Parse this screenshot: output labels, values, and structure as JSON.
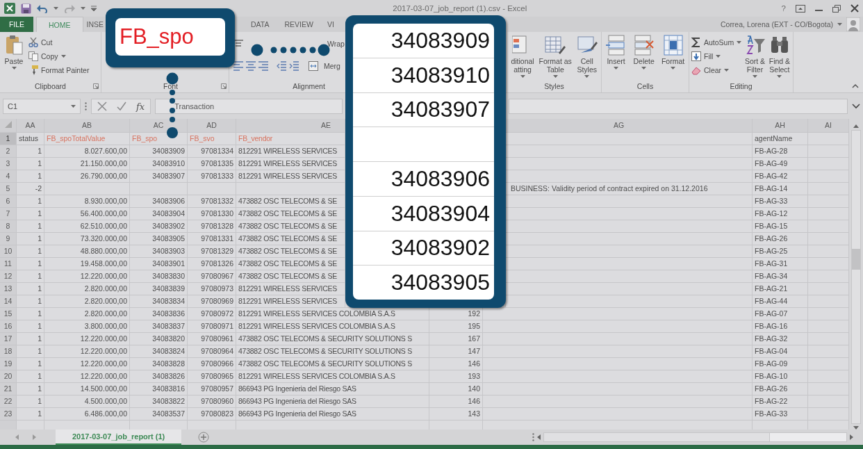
{
  "window": {
    "title": "2017-03-07_job_report (1).csv - Excel",
    "help": "?",
    "user": "Correa, Lorena (EXT - CO/Bogota)"
  },
  "ribbon_tabs": [
    {
      "label": "FILE",
      "kind": "file",
      "selected": false
    },
    {
      "label": "HOME",
      "kind": "tab",
      "selected": true
    },
    {
      "label": "INSE",
      "kind": "tab",
      "selected": false
    },
    {
      "label": "DATA",
      "kind": "tab",
      "selected": false
    },
    {
      "label": "REVIEW",
      "kind": "tab",
      "selected": false
    },
    {
      "label": "VI",
      "kind": "tab",
      "selected": false
    }
  ],
  "ribbon_groups": [
    {
      "label": "Clipboard",
      "commands": [
        {
          "label": "Paste",
          "kind": "large",
          "menu": true
        },
        {
          "label": "Cut",
          "kind": "small",
          "menu": false
        },
        {
          "label": "Copy",
          "kind": "small",
          "menu": true
        },
        {
          "label": "Format Painter",
          "kind": "small",
          "menu": false
        }
      ]
    },
    {
      "label": "Font"
    },
    {
      "label": "Alignment",
      "commands": [
        {
          "label": "Wrap",
          "kind": "small",
          "menu": false
        },
        {
          "label": "Merg",
          "kind": "small",
          "menu": false
        }
      ]
    },
    {
      "label": "Styles",
      "commands": [
        {
          "label": "ditional atting",
          "kind": "large",
          "menu": true
        },
        {
          "label": "Format as Table",
          "kind": "large",
          "menu": true
        },
        {
          "label": "Cell Styles",
          "kind": "large",
          "menu": true
        }
      ]
    },
    {
      "label": "Cells",
      "commands": [
        {
          "label": "Insert",
          "kind": "large",
          "menu": true
        },
        {
          "label": "Delete",
          "kind": "large",
          "menu": true
        },
        {
          "label": "Format",
          "kind": "large",
          "menu": true
        }
      ]
    },
    {
      "label": "Editing",
      "commands": [
        {
          "label": "AutoSum",
          "kind": "small",
          "menu": true
        },
        {
          "label": "Fill",
          "kind": "small",
          "menu": true
        },
        {
          "label": "Clear",
          "kind": "small",
          "menu": true
        },
        {
          "label": "Sort & Filter",
          "kind": "large",
          "menu": true
        },
        {
          "label": "Find & Select",
          "kind": "large",
          "menu": true
        }
      ]
    }
  ],
  "formula_bar": {
    "name_box": "C1",
    "function_label": "fx",
    "formula": "Transaction"
  },
  "sheet": {
    "columns": [
      {
        "label": "AA",
        "highlighted": false
      },
      {
        "label": "AB",
        "highlighted": true
      },
      {
        "label": "AC",
        "highlighted": true
      },
      {
        "label": "AD",
        "highlighted": true
      },
      {
        "label": "AE",
        "highlighted": true
      },
      {},
      {
        "label": "AG"
      },
      {
        "label": "AH",
        "highlighted": false
      },
      {
        "label": "AI"
      }
    ],
    "rows": [
      {
        "number": "1",
        "selected": true,
        "cells": [
          "status",
          "FB_spoTotalValue",
          "FB_spo",
          "FB_svo",
          "FB_vendor",
          null,
          null,
          "agentName"
        ]
      },
      {
        "number": "2",
        "selected": false,
        "cells": [
          "1",
          "8.027.600,00",
          "34083909",
          "97081334",
          "812291 WIRELESS SERVICES",
          null,
          null,
          "FB-AG-28"
        ]
      },
      {
        "number": "3",
        "selected": false,
        "cells": [
          "1",
          "21.150.000,00",
          "34083910",
          "97081335",
          "812291 WIRELESS SERVICES",
          null,
          null,
          "FB-AG-49"
        ]
      },
      {
        "number": "4",
        "selected": false,
        "cells": [
          "1",
          "26.790.000,00",
          "34083907",
          "97081333",
          "812291 WIRELESS SERVICES",
          null,
          null,
          "FB-AG-42"
        ]
      },
      {
        "number": "5",
        "selected": false,
        "cells": [
          "-2",
          null,
          null,
          null,
          null,
          null,
          "BUSINESS: Validity period of contract expired on 31.12.2016",
          "FB-AG-14"
        ]
      },
      {
        "number": "6",
        "selected": false,
        "cells": [
          "1",
          "8.930.000,00",
          "34083906",
          "97081332",
          "473882 OSC TELECOMS & SE",
          null,
          null,
          "FB-AG-33"
        ]
      },
      {
        "number": "7",
        "selected": false,
        "cells": [
          "1",
          "56.400.000,00",
          "34083904",
          "97081330",
          "473882 OSC TELECOMS & SE",
          null,
          null,
          "FB-AG-12"
        ]
      },
      {
        "number": "8",
        "selected": false,
        "cells": [
          "1",
          "62.510.000,00",
          "34083902",
          "97081328",
          "473882 OSC TELECOMS & SE",
          null,
          null,
          "FB-AG-15"
        ]
      },
      {
        "number": "9",
        "selected": false,
        "cells": [
          "1",
          "73.320.000,00",
          "34083905",
          "97081331",
          "473882 OSC TELECOMS & SE",
          null,
          null,
          "FB-AG-26"
        ]
      },
      {
        "number": "10",
        "selected": false,
        "cells": [
          "1",
          "48.880.000,00",
          "34083903",
          "97081329",
          "473882 OSC TELECOMS & SE",
          null,
          null,
          "FB-AG-25"
        ]
      },
      {
        "number": "11",
        "selected": false,
        "cells": [
          "1",
          "19.458.000,00",
          "34083901",
          "97081326",
          "473882 OSC TELECOMS & SE",
          null,
          null,
          "FB-AG-31"
        ]
      },
      {
        "number": "12",
        "selected": false,
        "cells": [
          "1",
          "12.220.000,00",
          "34083830",
          "97080967",
          "473882 OSC TELECOMS & SE",
          null,
          null,
          "FB-AG-34"
        ]
      },
      {
        "number": "13",
        "selected": false,
        "cells": [
          "1",
          "2.820.000,00",
          "34083839",
          "97080973",
          "812291 WIRELESS SERVICES",
          null,
          null,
          "FB-AG-21"
        ]
      },
      {
        "number": "14",
        "selected": false,
        "cells": [
          "1",
          "2.820.000,00",
          "34083834",
          "97080969",
          "812291 WIRELESS SERVICES",
          null,
          null,
          "FB-AG-44"
        ]
      },
      {
        "number": "15",
        "selected": false,
        "cells": [
          "1",
          "2.820.000,00",
          "34083836",
          "97080972",
          "812291 WIRELESS SERVICES COLOMBIA S.A.S",
          "192",
          null,
          "FB-AG-07"
        ]
      },
      {
        "number": "16",
        "selected": false,
        "cells": [
          "1",
          "3.800.000,00",
          "34083837",
          "97080971",
          "812291 WIRELESS SERVICES COLOMBIA S.A.S",
          "195",
          null,
          "FB-AG-16"
        ]
      },
      {
        "number": "17",
        "selected": false,
        "cells": [
          "1",
          "12.220.000,00",
          "34083820",
          "97080961",
          "473882 OSC TELECOMS & SECURITY SOLUTIONS S",
          "167",
          null,
          "FB-AG-32"
        ]
      },
      {
        "number": "18",
        "selected": false,
        "cells": [
          "1",
          "12.220.000,00",
          "34083824",
          "97080964",
          "473882 OSC TELECOMS & SECURITY SOLUTIONS S",
          "147",
          null,
          "FB-AG-04"
        ]
      },
      {
        "number": "19",
        "selected": false,
        "cells": [
          "1",
          "12.220.000,00",
          "34083828",
          "97080966",
          "473882 OSC TELECOMS & SECURITY SOLUTIONS S",
          "146",
          null,
          "FB-AG-09"
        ]
      },
      {
        "number": "20",
        "selected": false,
        "cells": [
          "1",
          "12.220.000,00",
          "34083826",
          "97080965",
          "812291 WIRELESS SERVICES COLOMBIA S.A.S",
          "193",
          null,
          "FB-AG-10"
        ]
      },
      {
        "number": "21",
        "selected": false,
        "cells": [
          "1",
          "14.500.000,00",
          "34083816",
          "97080957",
          "866943 PG Ingenieria del Riesgo SAS",
          "140",
          null,
          "FB-AG-26"
        ]
      },
      {
        "number": "22",
        "selected": false,
        "cells": [
          "1",
          "4.500.000,00",
          "34083822",
          "97080960",
          "866943 PG Ingenieria del Riesgo SAS",
          "146",
          null,
          "FB-AG-22"
        ]
      },
      {
        "number": "23",
        "selected": false,
        "cells": [
          "1",
          "6.486.000,00",
          "34083537",
          "97080823",
          "866943 PG Ingenieria del Riesgo SAS",
          "143",
          null,
          "FB-AG-33"
        ]
      }
    ]
  },
  "sheet_tabs": [
    {
      "label": "2017-03-07_job_report (1)",
      "selected": true
    }
  ],
  "callouts": [
    {
      "kind": "column_name",
      "text": "FB_spo"
    },
    {
      "kind": "values",
      "values": [
        {
          "kind": "number",
          "text": "34083909"
        },
        {
          "kind": "number",
          "text": "34083910"
        },
        {
          "kind": "number",
          "text": "34083907"
        },
        {
          "kind": "blank"
        },
        {
          "kind": "number",
          "text": "34083906"
        },
        {
          "kind": "number",
          "text": "34083904"
        },
        {
          "kind": "number",
          "text": "34083902"
        },
        {
          "kind": "number",
          "text": "34083905"
        }
      ]
    }
  ]
}
